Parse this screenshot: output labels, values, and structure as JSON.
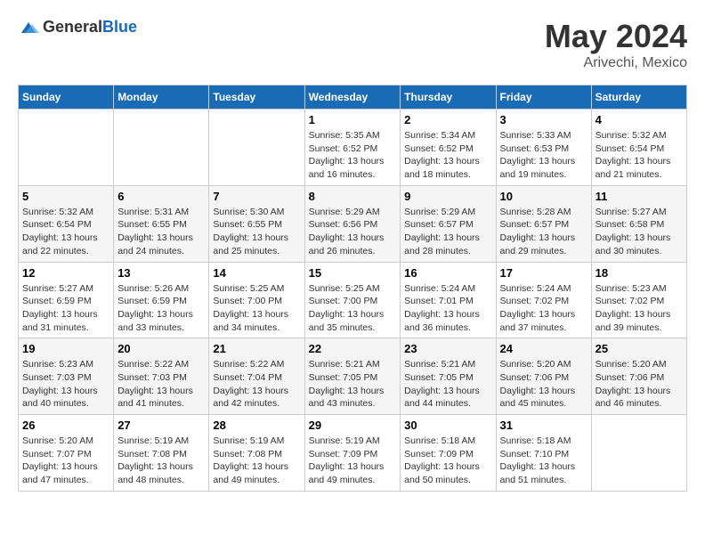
{
  "header": {
    "logo": {
      "general": "General",
      "blue": "Blue"
    },
    "month_year": "May 2024",
    "location": "Arivechi, Mexico"
  },
  "calendar": {
    "days_of_week": [
      "Sunday",
      "Monday",
      "Tuesday",
      "Wednesday",
      "Thursday",
      "Friday",
      "Saturday"
    ],
    "weeks": [
      [
        {
          "day": "",
          "info": ""
        },
        {
          "day": "",
          "info": ""
        },
        {
          "day": "",
          "info": ""
        },
        {
          "day": "1",
          "info": "Sunrise: 5:35 AM\nSunset: 6:52 PM\nDaylight: 13 hours and 16 minutes."
        },
        {
          "day": "2",
          "info": "Sunrise: 5:34 AM\nSunset: 6:52 PM\nDaylight: 13 hours and 18 minutes."
        },
        {
          "day": "3",
          "info": "Sunrise: 5:33 AM\nSunset: 6:53 PM\nDaylight: 13 hours and 19 minutes."
        },
        {
          "day": "4",
          "info": "Sunrise: 5:32 AM\nSunset: 6:54 PM\nDaylight: 13 hours and 21 minutes."
        }
      ],
      [
        {
          "day": "5",
          "info": "Sunrise: 5:32 AM\nSunset: 6:54 PM\nDaylight: 13 hours and 22 minutes."
        },
        {
          "day": "6",
          "info": "Sunrise: 5:31 AM\nSunset: 6:55 PM\nDaylight: 13 hours and 24 minutes."
        },
        {
          "day": "7",
          "info": "Sunrise: 5:30 AM\nSunset: 6:55 PM\nDaylight: 13 hours and 25 minutes."
        },
        {
          "day": "8",
          "info": "Sunrise: 5:29 AM\nSunset: 6:56 PM\nDaylight: 13 hours and 26 minutes."
        },
        {
          "day": "9",
          "info": "Sunrise: 5:29 AM\nSunset: 6:57 PM\nDaylight: 13 hours and 28 minutes."
        },
        {
          "day": "10",
          "info": "Sunrise: 5:28 AM\nSunset: 6:57 PM\nDaylight: 13 hours and 29 minutes."
        },
        {
          "day": "11",
          "info": "Sunrise: 5:27 AM\nSunset: 6:58 PM\nDaylight: 13 hours and 30 minutes."
        }
      ],
      [
        {
          "day": "12",
          "info": "Sunrise: 5:27 AM\nSunset: 6:59 PM\nDaylight: 13 hours and 31 minutes."
        },
        {
          "day": "13",
          "info": "Sunrise: 5:26 AM\nSunset: 6:59 PM\nDaylight: 13 hours and 33 minutes."
        },
        {
          "day": "14",
          "info": "Sunrise: 5:25 AM\nSunset: 7:00 PM\nDaylight: 13 hours and 34 minutes."
        },
        {
          "day": "15",
          "info": "Sunrise: 5:25 AM\nSunset: 7:00 PM\nDaylight: 13 hours and 35 minutes."
        },
        {
          "day": "16",
          "info": "Sunrise: 5:24 AM\nSunset: 7:01 PM\nDaylight: 13 hours and 36 minutes."
        },
        {
          "day": "17",
          "info": "Sunrise: 5:24 AM\nSunset: 7:02 PM\nDaylight: 13 hours and 37 minutes."
        },
        {
          "day": "18",
          "info": "Sunrise: 5:23 AM\nSunset: 7:02 PM\nDaylight: 13 hours and 39 minutes."
        }
      ],
      [
        {
          "day": "19",
          "info": "Sunrise: 5:23 AM\nSunset: 7:03 PM\nDaylight: 13 hours and 40 minutes."
        },
        {
          "day": "20",
          "info": "Sunrise: 5:22 AM\nSunset: 7:03 PM\nDaylight: 13 hours and 41 minutes."
        },
        {
          "day": "21",
          "info": "Sunrise: 5:22 AM\nSunset: 7:04 PM\nDaylight: 13 hours and 42 minutes."
        },
        {
          "day": "22",
          "info": "Sunrise: 5:21 AM\nSunset: 7:05 PM\nDaylight: 13 hours and 43 minutes."
        },
        {
          "day": "23",
          "info": "Sunrise: 5:21 AM\nSunset: 7:05 PM\nDaylight: 13 hours and 44 minutes."
        },
        {
          "day": "24",
          "info": "Sunrise: 5:20 AM\nSunset: 7:06 PM\nDaylight: 13 hours and 45 minutes."
        },
        {
          "day": "25",
          "info": "Sunrise: 5:20 AM\nSunset: 7:06 PM\nDaylight: 13 hours and 46 minutes."
        }
      ],
      [
        {
          "day": "26",
          "info": "Sunrise: 5:20 AM\nSunset: 7:07 PM\nDaylight: 13 hours and 47 minutes."
        },
        {
          "day": "27",
          "info": "Sunrise: 5:19 AM\nSunset: 7:08 PM\nDaylight: 13 hours and 48 minutes."
        },
        {
          "day": "28",
          "info": "Sunrise: 5:19 AM\nSunset: 7:08 PM\nDaylight: 13 hours and 49 minutes."
        },
        {
          "day": "29",
          "info": "Sunrise: 5:19 AM\nSunset: 7:09 PM\nDaylight: 13 hours and 49 minutes."
        },
        {
          "day": "30",
          "info": "Sunrise: 5:18 AM\nSunset: 7:09 PM\nDaylight: 13 hours and 50 minutes."
        },
        {
          "day": "31",
          "info": "Sunrise: 5:18 AM\nSunset: 7:10 PM\nDaylight: 13 hours and 51 minutes."
        },
        {
          "day": "",
          "info": ""
        }
      ]
    ]
  }
}
